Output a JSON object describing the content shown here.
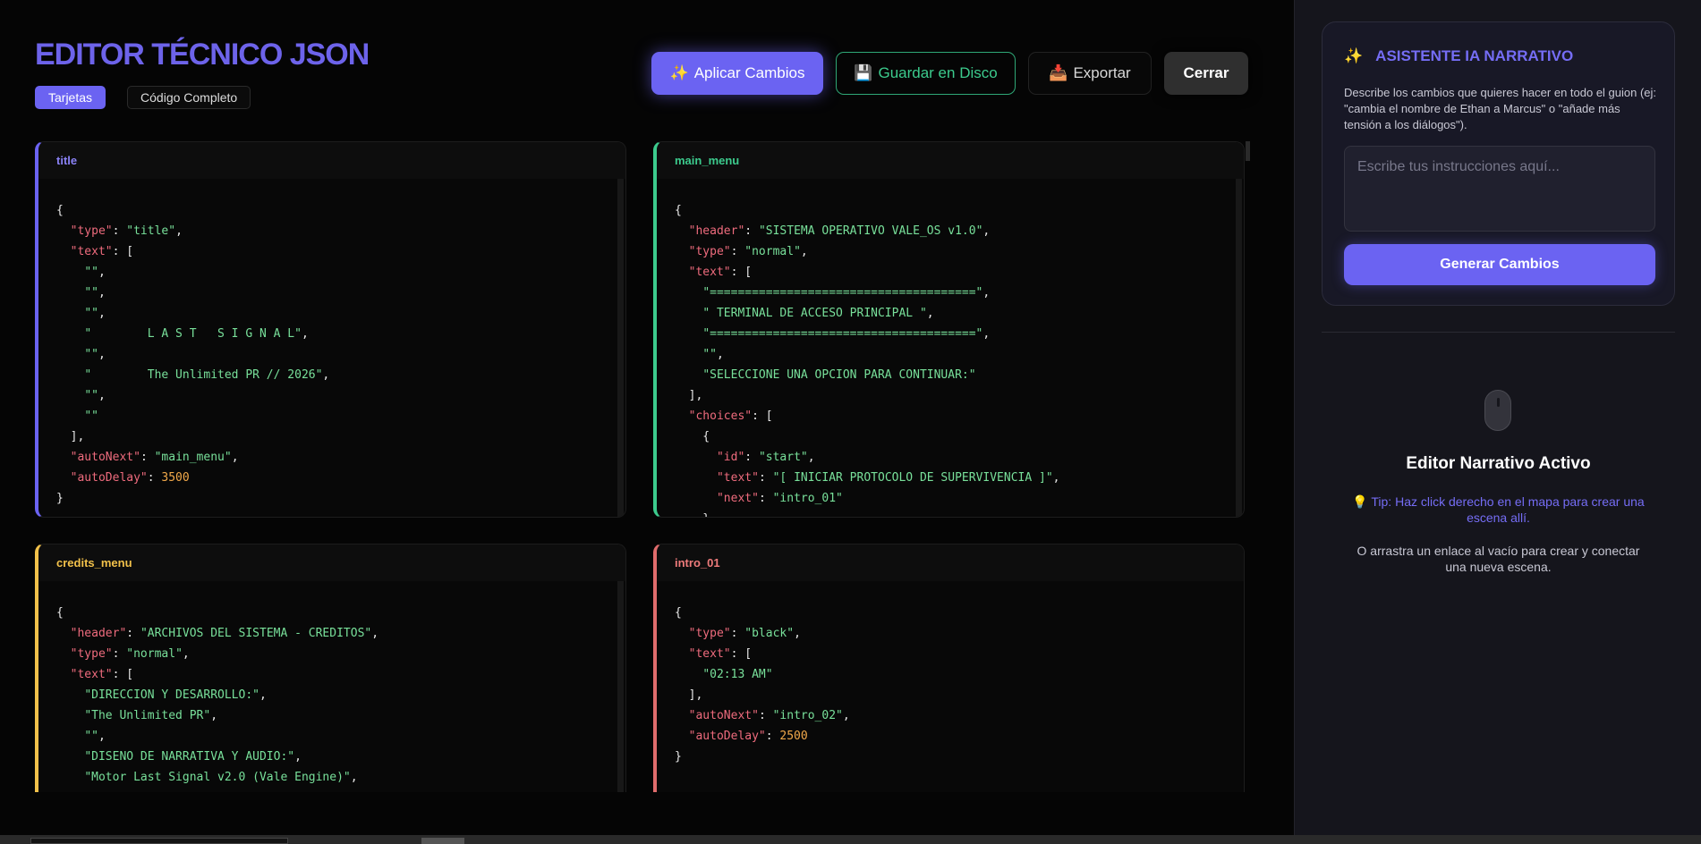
{
  "header": {
    "title": "EDITOR TÉCNICO JSON",
    "tabs": [
      {
        "label": "Tarjetas",
        "active": true
      },
      {
        "label": "Código Completo",
        "active": false
      }
    ]
  },
  "actions": {
    "apply": {
      "icon": "✨",
      "label": "Aplicar Cambios"
    },
    "save": {
      "icon": "💾",
      "label": "Guardar en Disco"
    },
    "export": {
      "icon": "📥",
      "label": "Exportar"
    },
    "close": {
      "label": "Cerrar"
    }
  },
  "cards": {
    "title": {
      "name": "title",
      "lines": [
        [
          [
            "p",
            "{"
          ]
        ],
        [
          [
            "p",
            "  "
          ],
          [
            "k",
            "\"type\""
          ],
          [
            "p",
            ": "
          ],
          [
            "s",
            "\"title\""
          ],
          [
            "p",
            ","
          ]
        ],
        [
          [
            "p",
            "  "
          ],
          [
            "k",
            "\"text\""
          ],
          [
            "p",
            ": ["
          ]
        ],
        [
          [
            "p",
            "    "
          ],
          [
            "s",
            "\"\""
          ],
          [
            "p",
            ","
          ]
        ],
        [
          [
            "p",
            "    "
          ],
          [
            "s",
            "\"\""
          ],
          [
            "p",
            ","
          ]
        ],
        [
          [
            "p",
            "    "
          ],
          [
            "s",
            "\"\""
          ],
          [
            "p",
            ","
          ]
        ],
        [
          [
            "p",
            "    "
          ],
          [
            "s",
            "\"        L A S T   S I G N A L\""
          ],
          [
            "p",
            ","
          ]
        ],
        [
          [
            "p",
            "    "
          ],
          [
            "s",
            "\"\""
          ],
          [
            "p",
            ","
          ]
        ],
        [
          [
            "p",
            "    "
          ],
          [
            "s",
            "\"        The Unlimited PR // 2026\""
          ],
          [
            "p",
            ","
          ]
        ],
        [
          [
            "p",
            "    "
          ],
          [
            "s",
            "\"\""
          ],
          [
            "p",
            ","
          ]
        ],
        [
          [
            "p",
            "    "
          ],
          [
            "s",
            "\"\""
          ]
        ],
        [
          [
            "p",
            "  ],"
          ]
        ],
        [
          [
            "p",
            "  "
          ],
          [
            "k",
            "\"autoNext\""
          ],
          [
            "p",
            ": "
          ],
          [
            "s",
            "\"main_menu\""
          ],
          [
            "p",
            ","
          ]
        ],
        [
          [
            "p",
            "  "
          ],
          [
            "k",
            "\"autoDelay\""
          ],
          [
            "p",
            ": "
          ],
          [
            "n",
            "3500"
          ]
        ],
        [
          [
            "p",
            "}"
          ]
        ]
      ]
    },
    "main_menu": {
      "name": "main_menu",
      "lines": [
        [
          [
            "p",
            "{"
          ]
        ],
        [
          [
            "p",
            "  "
          ],
          [
            "k",
            "\"header\""
          ],
          [
            "p",
            ": "
          ],
          [
            "s",
            "\"SISTEMA OPERATIVO VALE_OS v1.0\""
          ],
          [
            "p",
            ","
          ]
        ],
        [
          [
            "p",
            "  "
          ],
          [
            "k",
            "\"type\""
          ],
          [
            "p",
            ": "
          ],
          [
            "s",
            "\"normal\""
          ],
          [
            "p",
            ","
          ]
        ],
        [
          [
            "p",
            "  "
          ],
          [
            "k",
            "\"text\""
          ],
          [
            "p",
            ": ["
          ]
        ],
        [
          [
            "p",
            "    "
          ],
          [
            "s",
            "\"======================================\""
          ],
          [
            "p",
            ","
          ]
        ],
        [
          [
            "p",
            "    "
          ],
          [
            "s",
            "\" TERMINAL DE ACCESO PRINCIPAL \""
          ],
          [
            "p",
            ","
          ]
        ],
        [
          [
            "p",
            "    "
          ],
          [
            "s",
            "\"======================================\""
          ],
          [
            "p",
            ","
          ]
        ],
        [
          [
            "p",
            "    "
          ],
          [
            "s",
            "\"\""
          ],
          [
            "p",
            ","
          ]
        ],
        [
          [
            "p",
            "    "
          ],
          [
            "s",
            "\"SELECCIONE UNA OPCION PARA CONTINUAR:\""
          ]
        ],
        [
          [
            "p",
            "  ],"
          ]
        ],
        [
          [
            "p",
            "  "
          ],
          [
            "k",
            "\"choices\""
          ],
          [
            "p",
            ": ["
          ]
        ],
        [
          [
            "p",
            "    {"
          ]
        ],
        [
          [
            "p",
            "      "
          ],
          [
            "k",
            "\"id\""
          ],
          [
            "p",
            ": "
          ],
          [
            "s",
            "\"start\""
          ],
          [
            "p",
            ","
          ]
        ],
        [
          [
            "p",
            "      "
          ],
          [
            "k",
            "\"text\""
          ],
          [
            "p",
            ": "
          ],
          [
            "s",
            "\"[ INICIAR PROTOCOLO DE SUPERVIVENCIA ]\""
          ],
          [
            "p",
            ","
          ]
        ],
        [
          [
            "p",
            "      "
          ],
          [
            "k",
            "\"next\""
          ],
          [
            "p",
            ": "
          ],
          [
            "s",
            "\"intro_01\""
          ]
        ],
        [
          [
            "p",
            "    },"
          ]
        ]
      ]
    },
    "credits_menu": {
      "name": "credits_menu",
      "lines": [
        [
          [
            "p",
            "{"
          ]
        ],
        [
          [
            "p",
            "  "
          ],
          [
            "k",
            "\"header\""
          ],
          [
            "p",
            ": "
          ],
          [
            "s",
            "\"ARCHIVOS DEL SISTEMA - CREDITOS\""
          ],
          [
            "p",
            ","
          ]
        ],
        [
          [
            "p",
            "  "
          ],
          [
            "k",
            "\"type\""
          ],
          [
            "p",
            ": "
          ],
          [
            "s",
            "\"normal\""
          ],
          [
            "p",
            ","
          ]
        ],
        [
          [
            "p",
            "  "
          ],
          [
            "k",
            "\"text\""
          ],
          [
            "p",
            ": ["
          ]
        ],
        [
          [
            "p",
            "    "
          ],
          [
            "s",
            "\"DIRECCION Y DESARROLLO:\""
          ],
          [
            "p",
            ","
          ]
        ],
        [
          [
            "p",
            "    "
          ],
          [
            "s",
            "\"The Unlimited PR\""
          ],
          [
            "p",
            ","
          ]
        ],
        [
          [
            "p",
            "    "
          ],
          [
            "s",
            "\"\""
          ],
          [
            "p",
            ","
          ]
        ],
        [
          [
            "p",
            "    "
          ],
          [
            "s",
            "\"DISENO DE NARRATIVA Y AUDIO:\""
          ],
          [
            "p",
            ","
          ]
        ],
        [
          [
            "p",
            "    "
          ],
          [
            "s",
            "\"Motor Last Signal v2.0 (Vale Engine)\""
          ],
          [
            "p",
            ","
          ]
        ],
        [
          [
            "p",
            "    "
          ],
          [
            "s",
            "\"\""
          ],
          [
            "p",
            ","
          ]
        ]
      ]
    },
    "intro_01": {
      "name": "intro_01",
      "lines": [
        [
          [
            "p",
            "{"
          ]
        ],
        [
          [
            "p",
            "  "
          ],
          [
            "k",
            "\"type\""
          ],
          [
            "p",
            ": "
          ],
          [
            "s",
            "\"black\""
          ],
          [
            "p",
            ","
          ]
        ],
        [
          [
            "p",
            "  "
          ],
          [
            "k",
            "\"text\""
          ],
          [
            "p",
            ": ["
          ]
        ],
        [
          [
            "p",
            "    "
          ],
          [
            "s",
            "\"02:13 AM\""
          ]
        ],
        [
          [
            "p",
            "  ],"
          ]
        ],
        [
          [
            "p",
            "  "
          ],
          [
            "k",
            "\"autoNext\""
          ],
          [
            "p",
            ": "
          ],
          [
            "s",
            "\"intro_02\""
          ],
          [
            "p",
            ","
          ]
        ],
        [
          [
            "p",
            "  "
          ],
          [
            "k",
            "\"autoDelay\""
          ],
          [
            "p",
            ": "
          ],
          [
            "n",
            "2500"
          ]
        ],
        [
          [
            "p",
            "}"
          ]
        ]
      ]
    }
  },
  "sidebar": {
    "assistant": {
      "icon": "✨",
      "title": "ASISTENTE IA NARRATIVO",
      "description": "Describe los cambios que quieres hacer en todo el guion (ej: \"cambia el nombre de Ethan a Marcus\" o \"añade más tensión a los diálogos\").",
      "input_placeholder": "Escribe tus instrucciones aquí...",
      "input_value": "",
      "button": "Generar Cambios"
    },
    "empty_state": {
      "title": "Editor Narrativo Activo",
      "tip": "💡 Tip: Haz click derecho en el mapa para crear una escena allí.",
      "hint": "O arrastra un enlace al vacío para crear y conectar una nueva escena."
    }
  },
  "colors": {
    "accent": "#6b63f2",
    "save": "#3ccb8d",
    "key": "#ee6b7d",
    "string": "#78e09a",
    "number": "#f2a94a"
  }
}
